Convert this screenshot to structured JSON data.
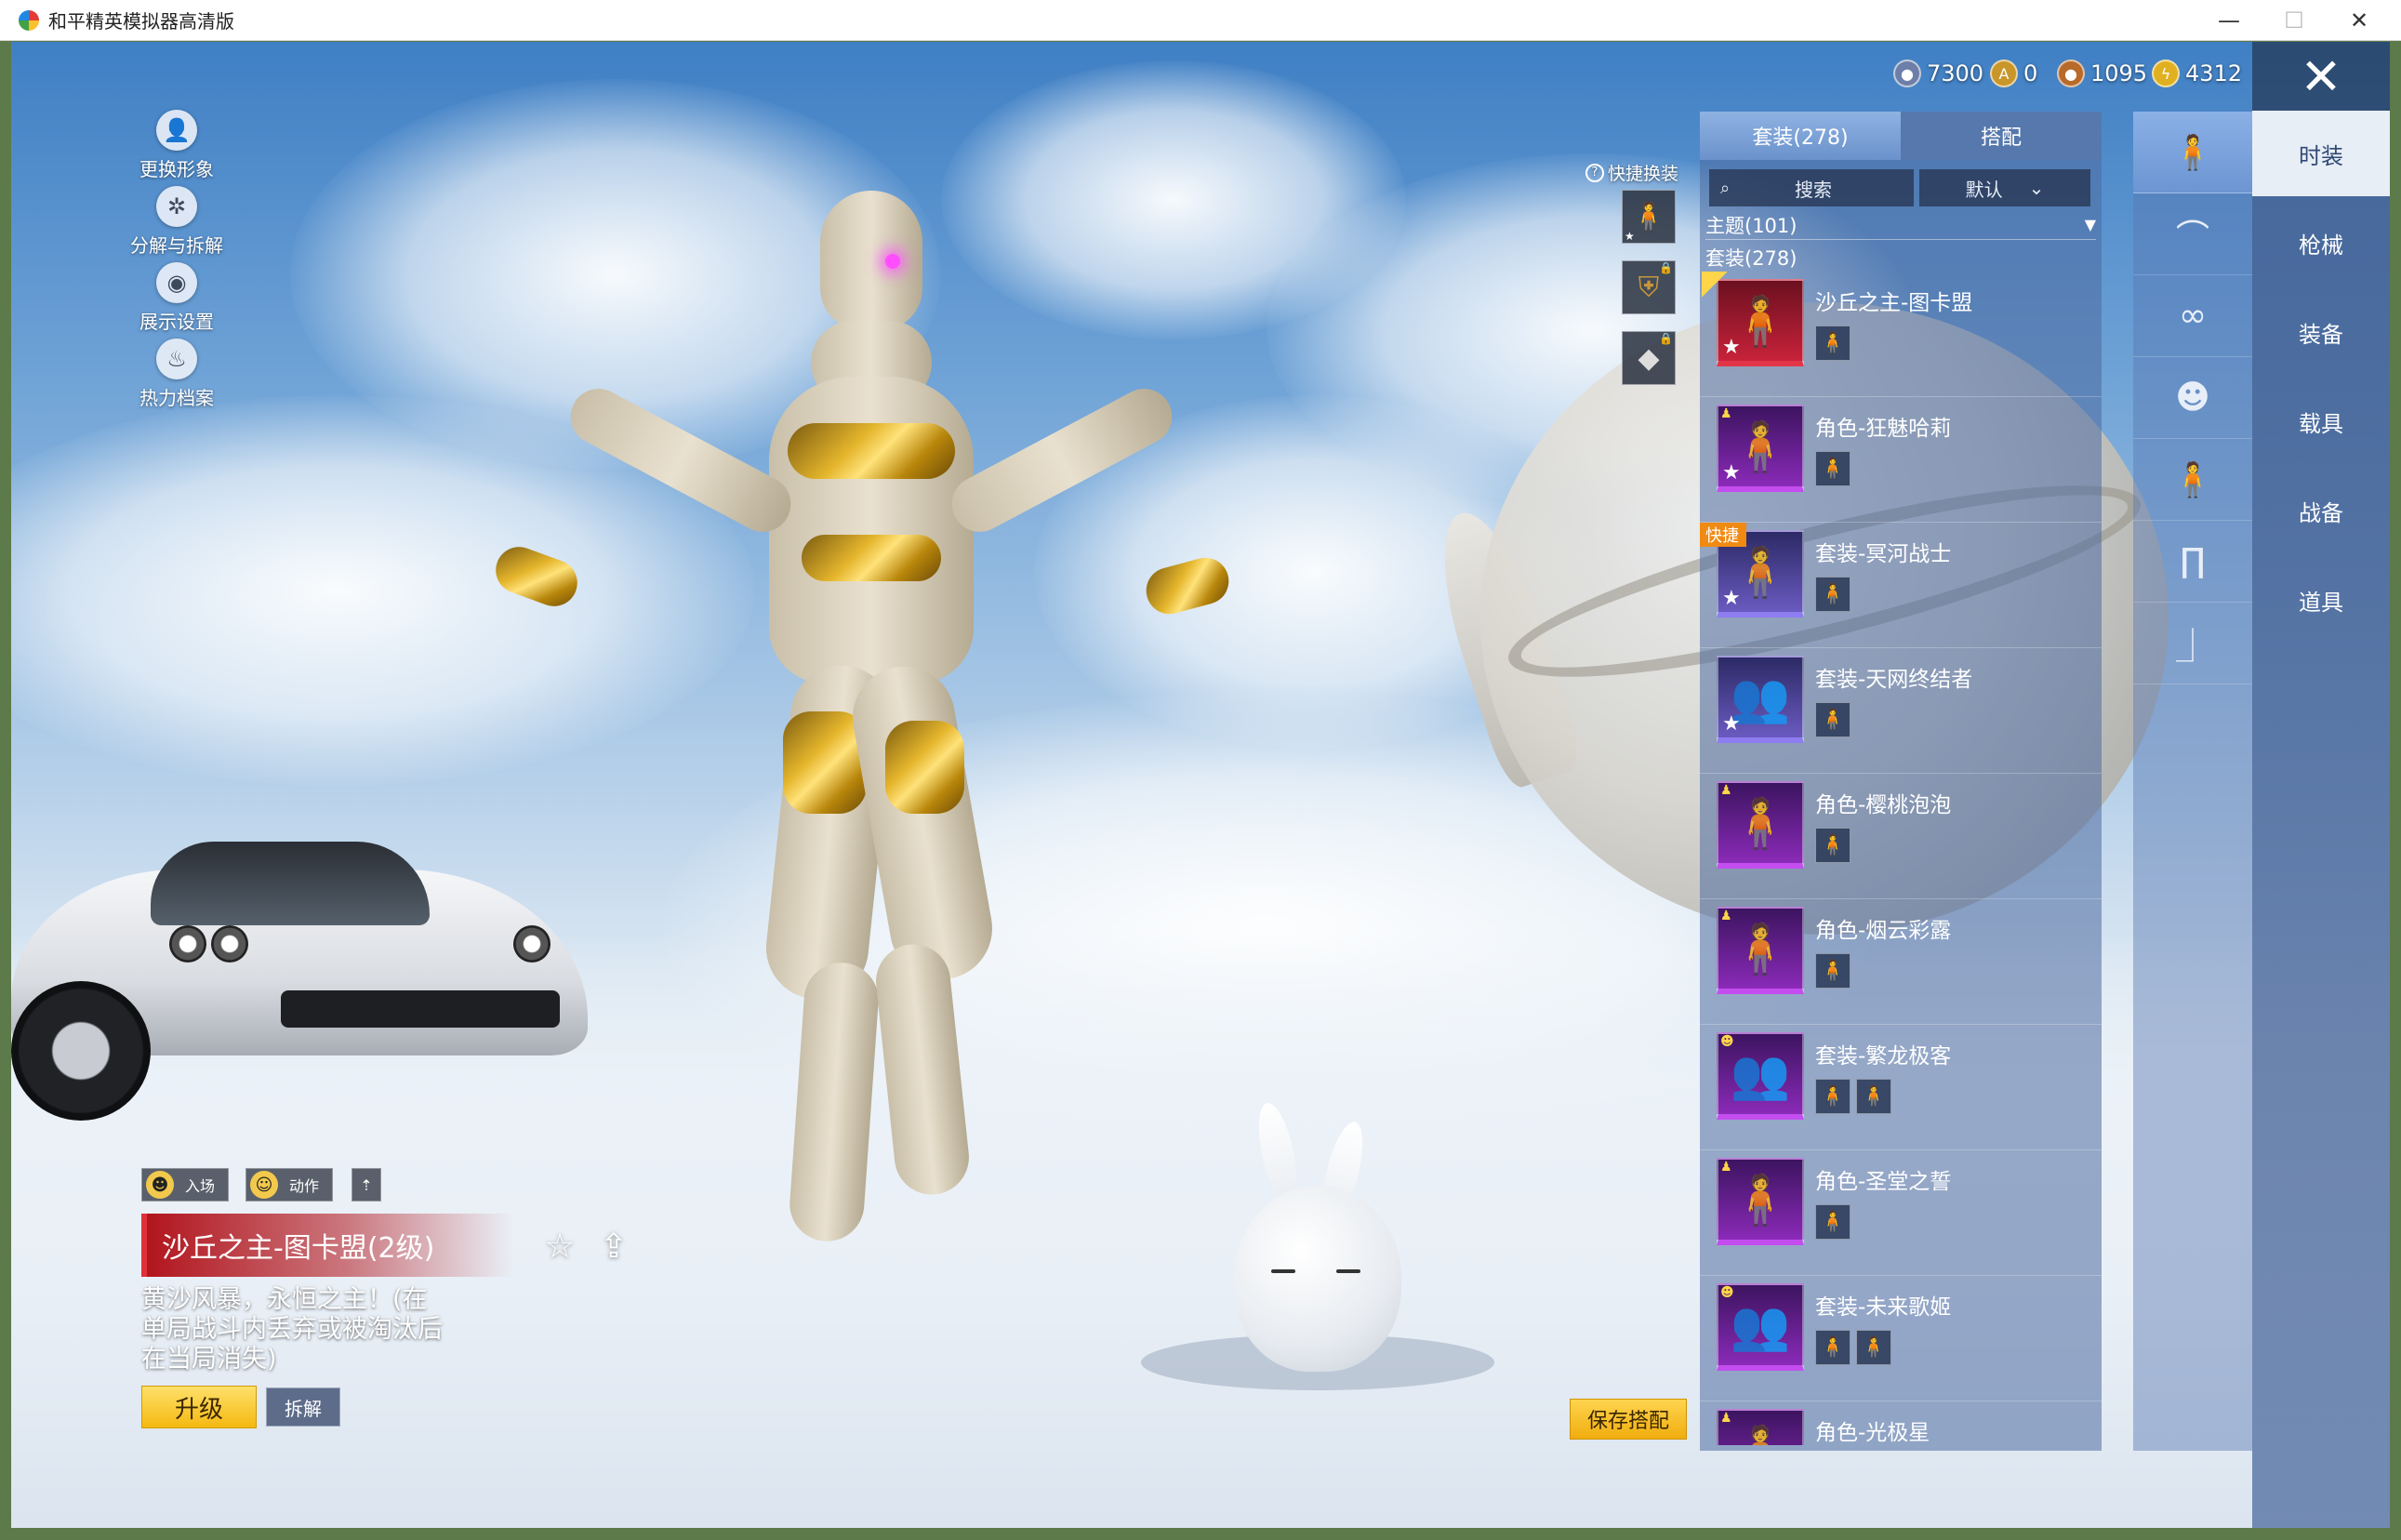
{
  "window": {
    "title": "和平精英模拟器高清版",
    "minimize": "—",
    "maximize": "☐",
    "close": "✕"
  },
  "currencies": [
    {
      "value": "7300",
      "icon": "silver-coin-icon",
      "color": "#6d7fa8"
    },
    {
      "value": "0",
      "icon": "gold-a-coin-icon",
      "color": "#c9962a"
    },
    {
      "value": "1095",
      "icon": "bronze-coin-icon",
      "color": "#b86a2a"
    },
    {
      "value": "4312",
      "icon": "lightning-coin-icon",
      "color": "#e0b020"
    }
  ],
  "left_tools": [
    {
      "label": "更换形象",
      "icon": "avatar-icon",
      "glyph": "👤"
    },
    {
      "label": "分解与拆解",
      "icon": "gear-icon",
      "glyph": "✲"
    },
    {
      "label": "展示设置",
      "icon": "eye-icon",
      "glyph": "◉"
    },
    {
      "label": "热力档案",
      "icon": "flame-icon",
      "glyph": "♨"
    }
  ],
  "actions": {
    "entrance": "入场",
    "motion": "动作",
    "up_arrow": "⇡"
  },
  "item": {
    "title": "沙丘之主-图卡盟(2级)",
    "description": "黄沙风暴，永恒之主！(在单局战斗内丢弃或被淘汰后在当局消失)",
    "upgrade": "升级",
    "dismantle": "拆解",
    "favorite_icon": "☆",
    "share_icon": "⇪"
  },
  "quick_swap": {
    "label": "快捷换装",
    "help": "?",
    "slots": [
      {
        "icon": "outfit-figure-icon",
        "glyph": "🧍"
      },
      {
        "icon": "helmet-badge-icon",
        "glyph": "⛨"
      },
      {
        "icon": "diamond-icon",
        "glyph": "◆"
      }
    ]
  },
  "save_outfit": "保存搭配",
  "panel": {
    "tabs": [
      "套装(278)",
      "搭配"
    ],
    "search_placeholder": "搜索",
    "sort": "默认",
    "filter": "主题(101)",
    "subheading": "套装(278)",
    "quick_badge": "快捷",
    "items": [
      {
        "name": "沙丘之主-图卡盟",
        "frame": "red",
        "minis": 1,
        "badge": "equipped"
      },
      {
        "name": "角色-狂魅哈莉",
        "frame": "purple",
        "minis": 1,
        "badge": ""
      },
      {
        "name": "套装-冥河战士",
        "frame": "violet",
        "minis": 1,
        "badge": "quick"
      },
      {
        "name": "套装-天网终结者",
        "frame": "violet",
        "minis": 1,
        "badge": ""
      },
      {
        "name": "角色-樱桃泡泡",
        "frame": "purple",
        "minis": 1,
        "badge": ""
      },
      {
        "name": "角色-烟云彩露",
        "frame": "purple",
        "minis": 1,
        "badge": ""
      },
      {
        "name": "套装-繁龙极客",
        "frame": "purple",
        "minis": 2,
        "badge": ""
      },
      {
        "name": "角色-圣堂之誓",
        "frame": "purple",
        "minis": 1,
        "badge": ""
      },
      {
        "name": "套装-未来歌姬",
        "frame": "purple",
        "minis": 2,
        "badge": ""
      },
      {
        "name": "角色-光极星",
        "frame": "purple",
        "minis": 1,
        "badge": ""
      }
    ]
  },
  "categories": [
    {
      "icon": "full-outfit-icon",
      "glyph": "🧍"
    },
    {
      "icon": "cap-icon",
      "glyph": "⌒"
    },
    {
      "icon": "glasses-icon",
      "glyph": "∞"
    },
    {
      "icon": "mask-icon",
      "glyph": "☻"
    },
    {
      "icon": "body-icon",
      "glyph": "🧍"
    },
    {
      "icon": "pants-icon",
      "glyph": "∏"
    },
    {
      "icon": "shoes-icon",
      "glyph": "⏌"
    }
  ],
  "main_nav": [
    "时装",
    "枪械",
    "装备",
    "载具",
    "战备",
    "道具"
  ],
  "close_icon": "✕"
}
